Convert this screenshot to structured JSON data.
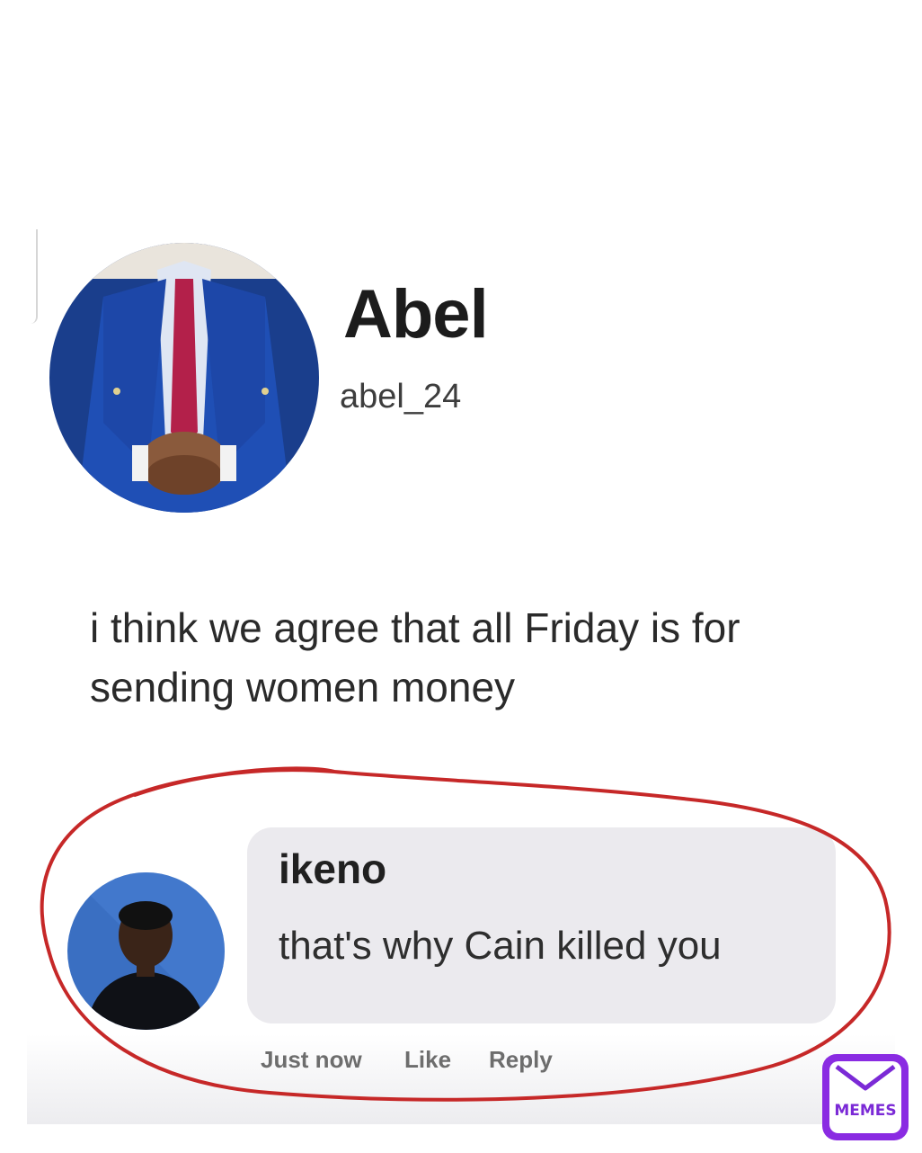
{
  "post": {
    "author_name": "Abel",
    "author_handle": "abel_24",
    "text": "i think we agree that all Friday is for sending women money"
  },
  "comment": {
    "author_name": "ikeno",
    "text": "that's why Cain killed you",
    "actions": {
      "time_label": "Just now",
      "like_label": "Like",
      "reply_label": "Reply"
    }
  },
  "watermark": {
    "label": "MEMES",
    "icon": "envelope-icon"
  },
  "colors": {
    "highlight_circle": "#c62828",
    "comment_bubble": "#ebeaee",
    "badge": "#8a2be2"
  }
}
